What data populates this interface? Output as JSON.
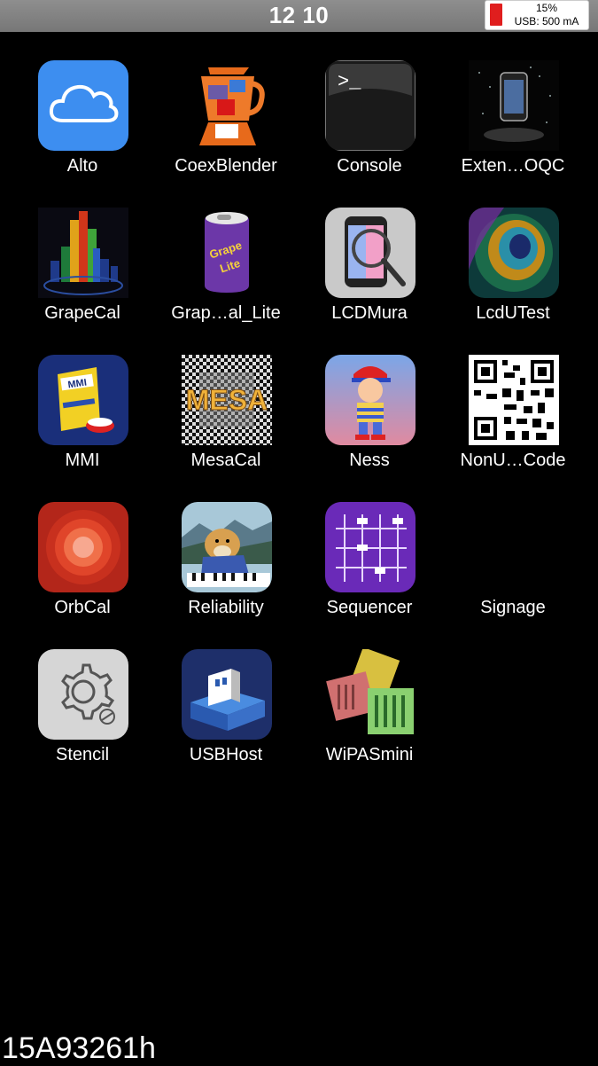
{
  "status": {
    "time": "12 10",
    "battery_percent": "15%",
    "usb": "USB: 500 mA",
    "battery_color": "#e01e1e"
  },
  "apps": [
    {
      "label": "Alto",
      "icon": "cloud-icon"
    },
    {
      "label": "CoexBlender",
      "icon": "blender-icon"
    },
    {
      "label": "Console",
      "icon": "terminal-icon"
    },
    {
      "label": "Exten…OQC",
      "icon": "phone-stand-icon"
    },
    {
      "label": "GrapeCal",
      "icon": "3d-bars-icon"
    },
    {
      "label": "Grap…al_Lite",
      "icon": "grape-can-icon"
    },
    {
      "label": "LCDMura",
      "icon": "phone-magnifier-icon"
    },
    {
      "label": "LcdUTest",
      "icon": "peacock-feather-icon"
    },
    {
      "label": "MMI",
      "icon": "cereal-box-icon"
    },
    {
      "label": "MesaCal",
      "icon": "mesa-icon"
    },
    {
      "label": "Ness",
      "icon": "ness-character-icon"
    },
    {
      "label": "NonU…Code",
      "icon": "qr-code-icon"
    },
    {
      "label": "OrbCal",
      "icon": "orb-icon"
    },
    {
      "label": "Reliability",
      "icon": "doge-piano-icon"
    },
    {
      "label": "Sequencer",
      "icon": "sliders-icon"
    },
    {
      "label": "Signage",
      "icon": ""
    },
    {
      "label": "Stencil",
      "icon": "gear-icon"
    },
    {
      "label": "USBHost",
      "icon": "usb-icon"
    },
    {
      "label": "WiPASmini",
      "icon": "chips-icon"
    }
  ],
  "icon_texts": {
    "mmi": "MMI",
    "mesa": "MESA",
    "grape": "Grape",
    "lite": "Lite",
    "console_prompt": ">_"
  },
  "footer": "15A93261h"
}
